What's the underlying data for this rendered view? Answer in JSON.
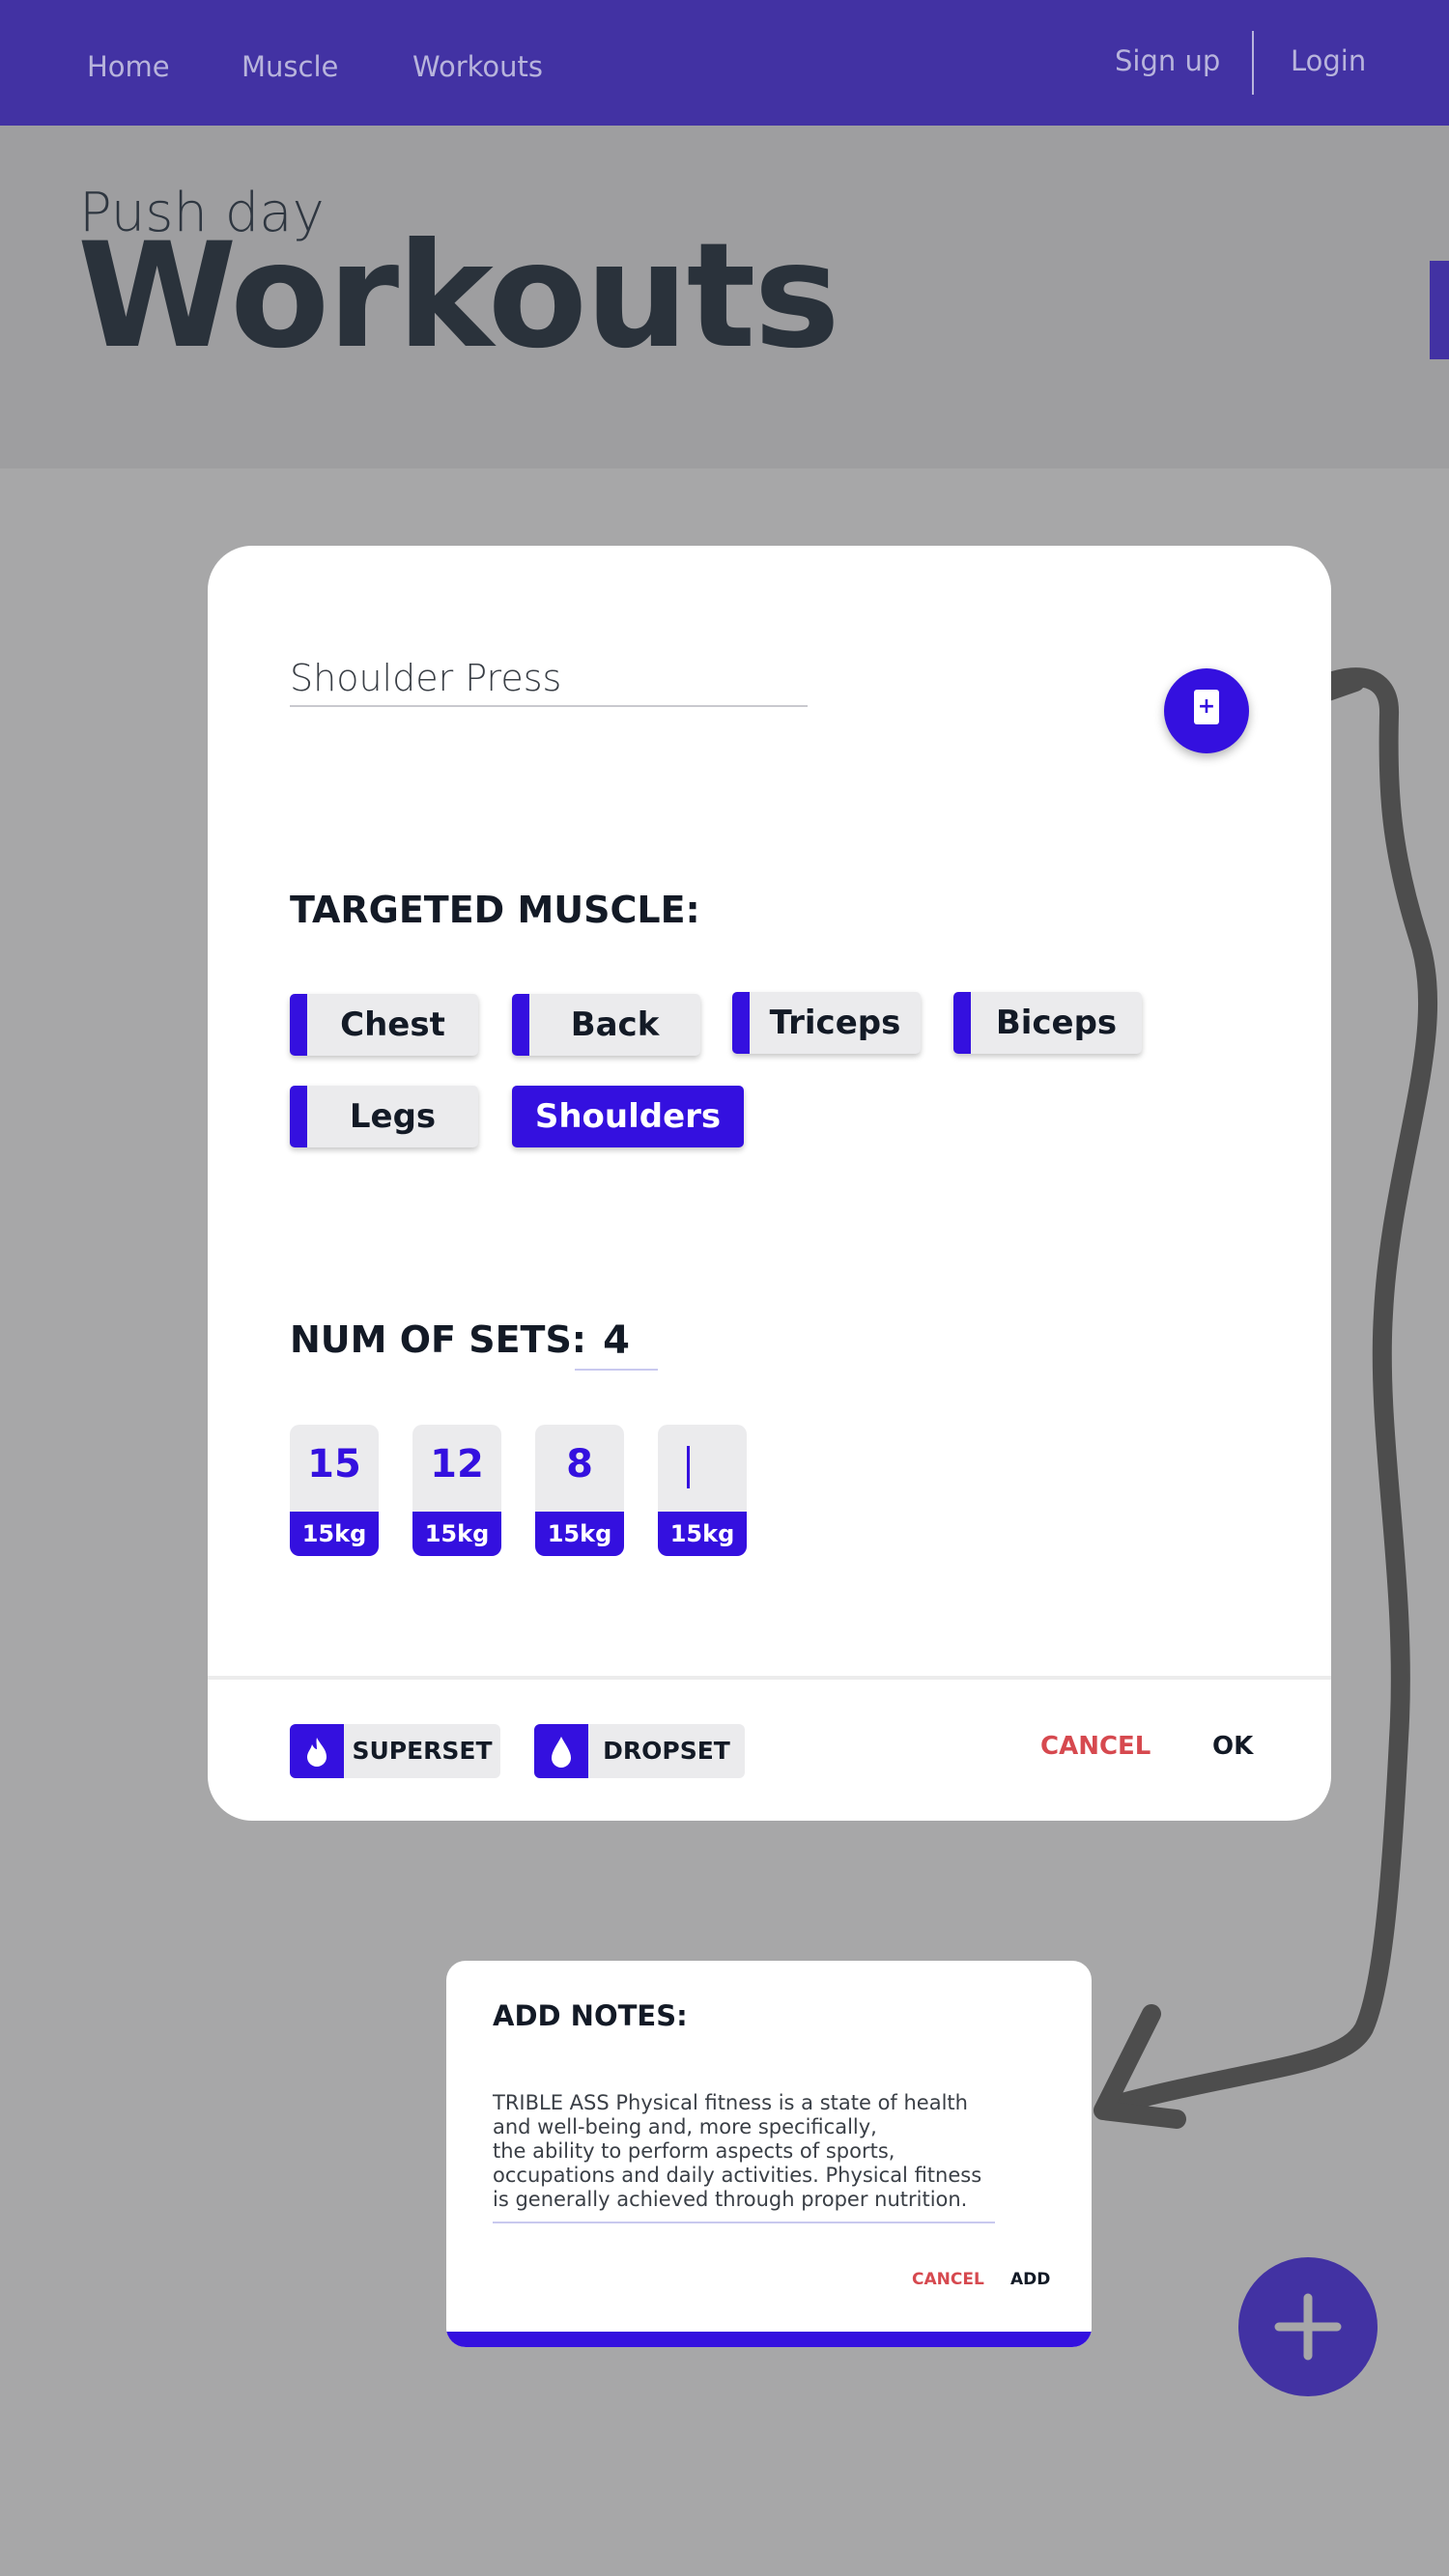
{
  "nav": {
    "home": "Home",
    "muscle": "Muscle",
    "workouts": "Workouts",
    "signup": "Sign up",
    "login": "Login"
  },
  "header": {
    "subtitle": "Push day",
    "title": "Workouts"
  },
  "card": {
    "exercise_name": "Shoulder Press",
    "targeted_label": "TARGETED MUSCLE:",
    "muscles": [
      {
        "label": "Chest",
        "selected": false
      },
      {
        "label": "Back",
        "selected": false
      },
      {
        "label": "Triceps",
        "selected": false
      },
      {
        "label": "Biceps",
        "selected": false
      },
      {
        "label": "Legs",
        "selected": false
      },
      {
        "label": "Shoulders",
        "selected": true
      }
    ],
    "sets_label": "NUM OF SETS:",
    "sets_value": "4",
    "sets": [
      {
        "reps": "15",
        "weight": "15kg"
      },
      {
        "reps": "12",
        "weight": "15kg"
      },
      {
        "reps": "8",
        "weight": "15kg"
      },
      {
        "reps": "",
        "weight": "15kg"
      }
    ],
    "superset_label": "SUPERSET",
    "dropset_label": "DROPSET",
    "cancel_label": "CANCEL",
    "ok_label": "OK"
  },
  "notes": {
    "title": "ADD NOTES:",
    "text": "TRIBLE ASS Physical fitness is a state of health\nand well-being and, more specifically,\nthe ability to perform aspects of sports,\noccupations and daily activities. Physical fitness\nis generally achieved through proper nutrition.",
    "cancel_label": "CANCEL",
    "add_label": "ADD"
  },
  "colors": {
    "accent": "#3410df",
    "nav": "#4232a3",
    "cancel": "#d6494f",
    "background": "#a7a7a8"
  },
  "icons": {
    "add_exercise": "add-document-icon",
    "superset": "flame-icon",
    "dropset": "droplet-icon",
    "fab": "plus-icon"
  }
}
